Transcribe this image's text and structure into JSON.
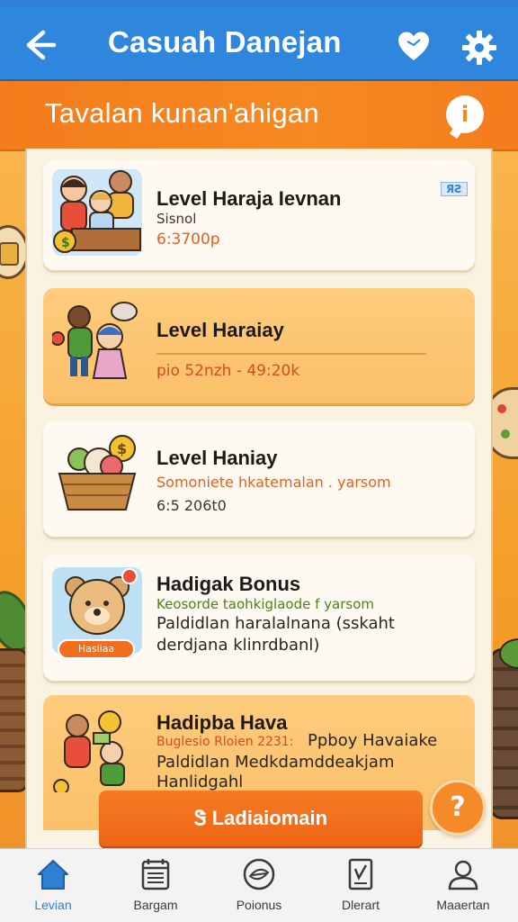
{
  "header": {
    "title": "Casuah Danejan",
    "back_icon": "arrow-left-icon",
    "heart_icon": "heart-icon",
    "settings_icon": "gear-icon",
    "bg_color": "#2f86dd"
  },
  "banner": {
    "title": "Tavalan kunan'ahigan",
    "help_label": "i"
  },
  "cards": [
    {
      "title": "Level Haraja Ievnan",
      "line1": "Sisnol",
      "line2": "6:3700p",
      "badge": "ЯƧ"
    },
    {
      "title": "Level Haraiay",
      "line1": "pio 52nzh - 49:20k"
    },
    {
      "title": "Level Haniay",
      "line1": "Somoniete hkatemalan . yarsom",
      "line2": "6:5 206t0"
    },
    {
      "title": "Hadigak Bonus",
      "line1": "Keosorde taohkiglaode f yarsom",
      "line2": "Paldidlan haralalnana (sskaht",
      "line3": "derdjana klinrdbanl)",
      "mini_badge": "Hasiiaa"
    },
    {
      "title": "Hadipba Hava",
      "line1": "Buglesio Rloien 2231:",
      "line1b": "Ppboy Havaiake",
      "line2": "Paldidlan Medkdamddeakjam",
      "line3": "Hanlidgahl"
    }
  ],
  "action_button": {
    "label": "Ꮥ Ladiaiomain"
  },
  "fab": {
    "label": "?"
  },
  "bottom_nav": {
    "items": [
      {
        "label": "Levian",
        "icon": "home-icon",
        "active": true
      },
      {
        "label": "Bargam",
        "icon": "calendar-icon",
        "active": false
      },
      {
        "label": "Poionus",
        "icon": "leaf-badge-icon",
        "active": false
      },
      {
        "label": "Dlerart",
        "icon": "document-icon",
        "active": false
      },
      {
        "label": "Maaertan",
        "icon": "user-icon",
        "active": false
      }
    ]
  }
}
